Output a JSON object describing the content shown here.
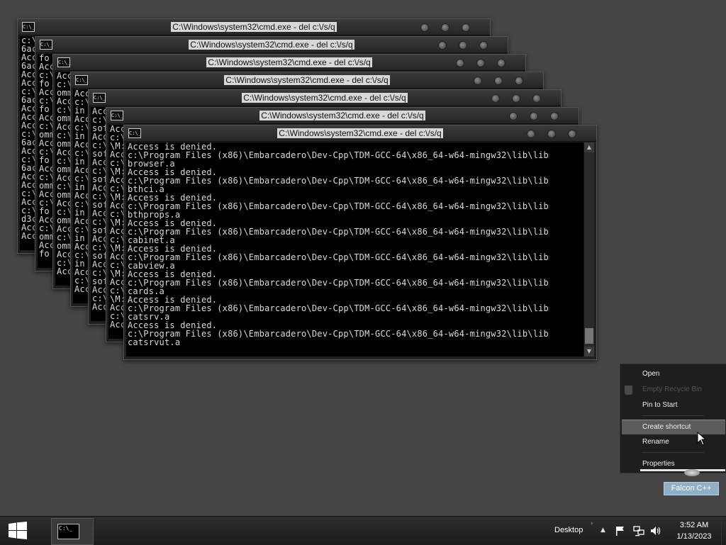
{
  "windows": [
    {
      "title": "C:\\Windows\\system32\\cmd.exe - del  c:\\/s/q",
      "lines": [
        "c:\\",
        "6ac",
        "Acc",
        "6ac",
        "Acc",
        "Acc",
        "c:\\",
        "6ac",
        "Acc",
        "Acc",
        "Acc",
        "c:\\",
        "6ac",
        "Acc",
        "c:\\",
        "6ac",
        "Acc",
        "Acc",
        "c:\\",
        "Acc",
        "c:\\",
        "d3c",
        "Acc",
        "Acc"
      ]
    },
    {
      "title": "C:\\Windows\\system32\\cmd.exe - del  c:\\/s/q",
      "lines": [
        "fo",
        "Acc",
        "c:\\",
        "fo",
        "Acc",
        "c:\\",
        "fo",
        "Acc",
        "c:\\",
        "omm",
        "Acc",
        "c:\\",
        "fo",
        "Acc",
        "c:\\",
        "omm",
        "Acc",
        "c:\\",
        "fo",
        "Acc",
        "c:\\",
        "omm",
        "Acc",
        "fo"
      ]
    },
    {
      "title": "C:\\Windows\\system32\\cmd.exe - del  c:\\/s/q",
      "lines": [
        "Acc",
        "c:\\",
        "omm",
        "Acc",
        "c:\\",
        "omm",
        "Acc",
        "c:\\",
        "omm",
        "Acc",
        "c:\\",
        "omm",
        "Acc",
        "c:\\",
        "omm",
        "Acc",
        "c:\\",
        "omm",
        "Acc",
        "c:\\",
        "omm",
        "Acc",
        "c:\\",
        "Acc"
      ]
    },
    {
      "title": "C:\\Windows\\system32\\cmd.exe - del  c:\\/s/q",
      "lines": [
        "Acc",
        "c:\\",
        "in",
        "Acc",
        "c:\\",
        "in",
        "Acc",
        "c:\\",
        "in",
        "Acc",
        "c:\\",
        "in",
        "Acc",
        "c:\\",
        "in",
        "Acc",
        "c:\\",
        "in",
        "Acc",
        "c:\\",
        "in",
        "Acc",
        "c:\\",
        "Acc"
      ]
    },
    {
      "title": "C:\\Windows\\system32\\cmd.exe - del  c:\\/s/q",
      "lines": [
        "Acc",
        "c:\\",
        "sof",
        "Acc",
        "c:\\",
        "sof",
        "Acc",
        "c:\\",
        "sof",
        "Acc",
        "c:\\",
        "sof",
        "Acc",
        "c:\\",
        "sof",
        "Acc",
        "c:\\",
        "sof",
        "Acc",
        "c:\\",
        "sof",
        "Acc",
        "c:\\",
        "Acc"
      ]
    },
    {
      "title": "C:\\Windows\\system32\\cmd.exe - del  c:\\/s/q",
      "lines": [
        "Acc",
        "c:\\",
        "\\M:",
        "Acc",
        "c:\\",
        "\\M:",
        "Acc",
        "c:\\",
        "\\M:",
        "Acc",
        "c:\\",
        "\\M:",
        "Acc",
        "c:\\",
        "\\M:",
        "Acc",
        "c:\\",
        "\\M:",
        "Acc",
        "c:\\",
        "\\M:",
        "Acc",
        "c:\\",
        "Acc"
      ]
    },
    {
      "title": "C:\\Windows\\system32\\cmd.exe - del  c:\\/s/q",
      "lines": [
        "Access is denied.",
        "c:\\Program Files (x86)\\Embarcadero\\Dev-Cpp\\TDM-GCC-64\\x86_64-w64-mingw32\\lib\\lib",
        "browser.a",
        "Access is denied.",
        "c:\\Program Files (x86)\\Embarcadero\\Dev-Cpp\\TDM-GCC-64\\x86_64-w64-mingw32\\lib\\lib",
        "bthci.a",
        "Access is denied.",
        "c:\\Program Files (x86)\\Embarcadero\\Dev-Cpp\\TDM-GCC-64\\x86_64-w64-mingw32\\lib\\lib",
        "bthprops.a",
        "Access is denied.",
        "c:\\Program Files (x86)\\Embarcadero\\Dev-Cpp\\TDM-GCC-64\\x86_64-w64-mingw32\\lib\\lib",
        "cabinet.a",
        "Access is denied.",
        "c:\\Program Files (x86)\\Embarcadero\\Dev-Cpp\\TDM-GCC-64\\x86_64-w64-mingw32\\lib\\lib",
        "cabview.a",
        "Access is denied.",
        "c:\\Program Files (x86)\\Embarcadero\\Dev-Cpp\\TDM-GCC-64\\x86_64-w64-mingw32\\lib\\lib",
        "cards.a",
        "Access is denied.",
        "c:\\Program Files (x86)\\Embarcadero\\Dev-Cpp\\TDM-GCC-64\\x86_64-w64-mingw32\\lib\\lib",
        "catsrv.a",
        "Access is denied.",
        "c:\\Program Files (x86)\\Embarcadero\\Dev-Cpp\\TDM-GCC-64\\x86_64-w64-mingw32\\lib\\lib",
        "catsrvut.a"
      ]
    }
  ],
  "context_menu": {
    "open": "Open",
    "empty_recycle_bin": "Empty Recycle Bin",
    "pin_to_start": "Pin to Start",
    "create_shortcut": "Create shortcut",
    "rename": "Rename",
    "properties": "Properties"
  },
  "desktop_icon": {
    "label": "Falcon C++"
  },
  "taskbar": {
    "start_icon": "windows-logo-icon",
    "cmd_icon_text": "C:\\_",
    "desktop_label": "Desktop",
    "time": "3:52 AM",
    "date": "1/13/2023"
  }
}
